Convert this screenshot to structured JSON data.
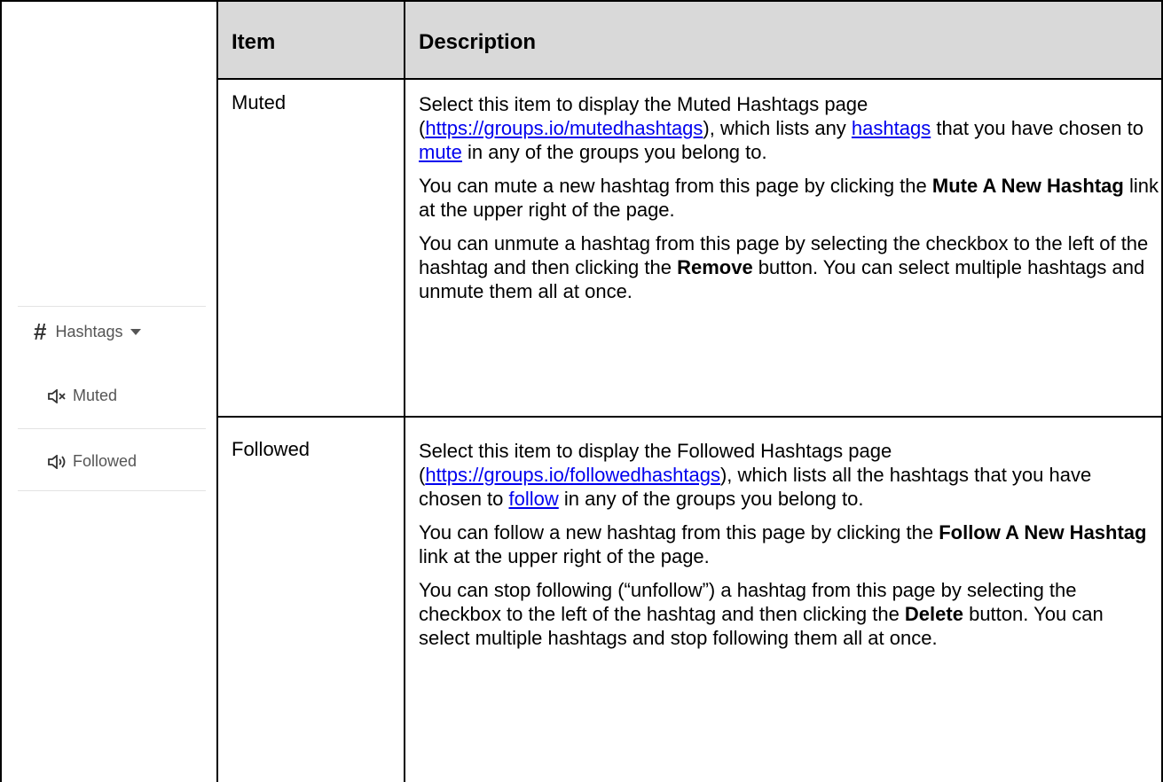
{
  "table": {
    "headers": {
      "item": "Item",
      "description": "Description"
    },
    "rows": [
      {
        "item": "Muted",
        "paragraphs": [
          {
            "p1_a": "Select this item to display the Muted Hashtags page (",
            "link1": "https://groups.io/mutedhashtags",
            "p1_b": "), which lists any ",
            "link2": "hashtags",
            "p1_c": " that you have chosen to ",
            "link3": "mute",
            "p1_d": " in any of the groups you belong to."
          },
          {
            "a": "You can mute a new hashtag from this page by clicking the ",
            "bold": "Mute A New Hashtag",
            "b": " link at the upper right of the page."
          },
          {
            "a": "You can unmute a hashtag from this page by selecting the checkbox to the left of the hashtag and then clicking the ",
            "bold": "Remove",
            "b": " button. You can select multiple hashtags and unmute them all at once."
          }
        ]
      },
      {
        "item": "Followed",
        "paragraphs": [
          {
            "p1_a": "Select this item to display the Followed Hashtags page (",
            "link1": "https://groups.io/followedhashtags",
            "p1_b": "), which lists all the hashtags that you have chosen to ",
            "link2": "follow",
            "p1_c": " in any of the groups you belong to."
          },
          {
            "a": "You can follow a new hashtag from this page by clicking the ",
            "bold": "Follow A New Hashtag",
            "b": " link at the upper right of the page."
          },
          {
            "a": "You can stop following (“unfollow”) a hashtag from this page by selecting the checkbox to the left of the hashtag and then clicking the ",
            "bold": "Delete",
            "b": " button. You can select multiple hashtags and stop following them all at once."
          }
        ]
      }
    ]
  },
  "menu": {
    "parent_label": "Hashtags",
    "parent_icon": "hash-icon",
    "items": [
      {
        "label": "Muted",
        "icon": "speaker-muted-icon"
      },
      {
        "label": "Followed",
        "icon": "speaker-on-icon"
      }
    ]
  }
}
